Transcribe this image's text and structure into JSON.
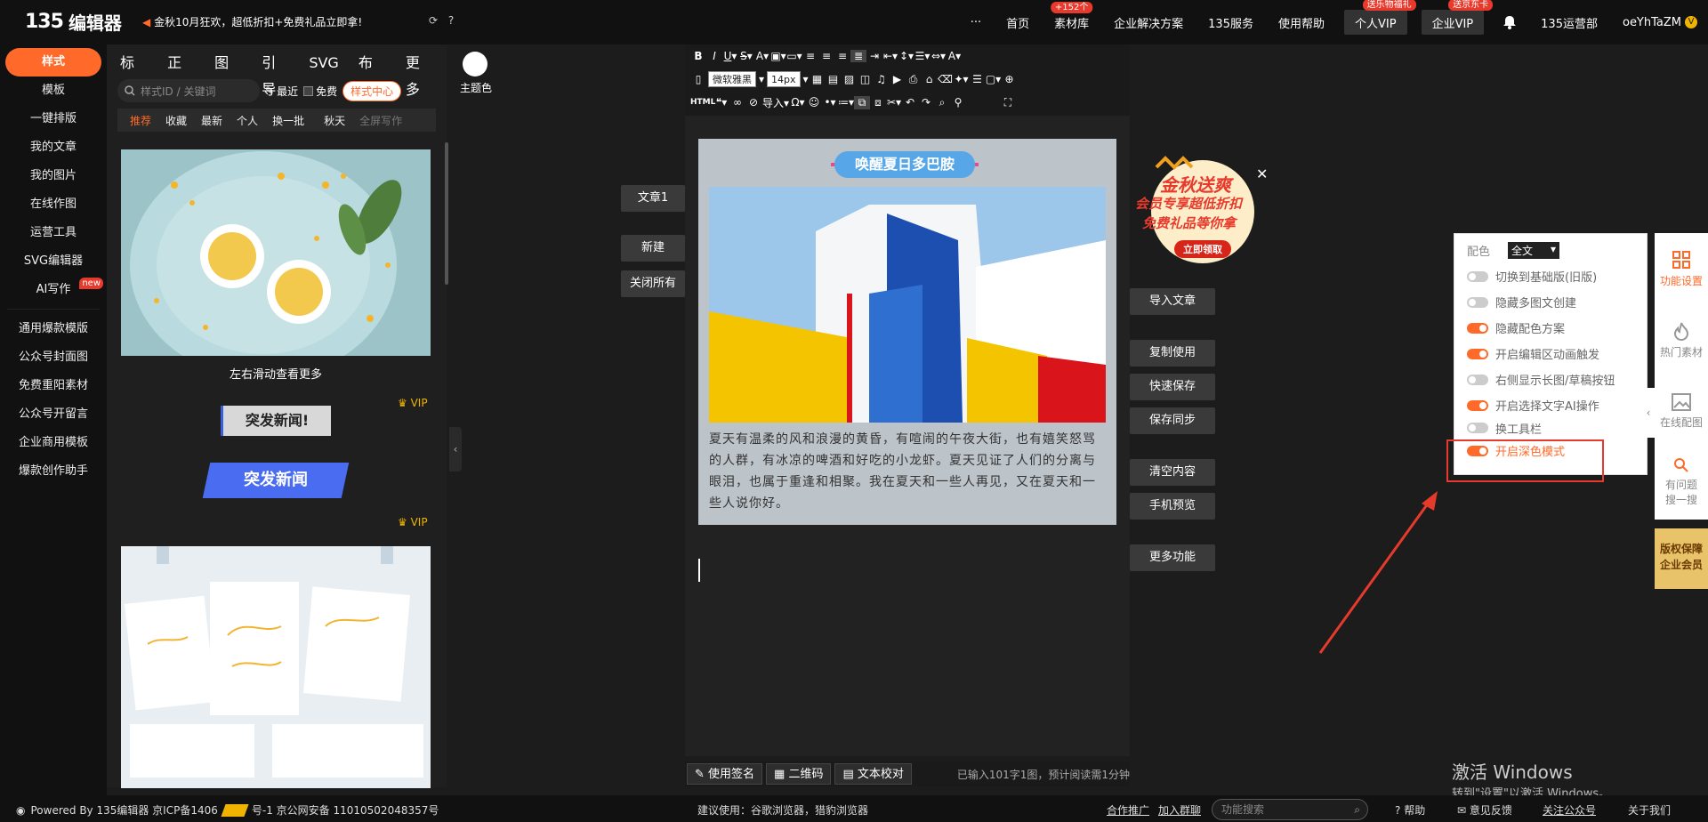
{
  "header": {
    "logo_num": "135",
    "logo_text": "编辑器",
    "promo": "金秋10月狂欢，超低折扣+免费礼品立即拿!",
    "nav": [
      {
        "label": "···"
      },
      {
        "label": "首页"
      },
      {
        "label": "素材库",
        "badge": "+152个"
      },
      {
        "label": "企业解决方案"
      },
      {
        "label": "135服务"
      },
      {
        "label": "使用帮助"
      }
    ],
    "vip_personal": "个人VIP",
    "vip_personal_badge": "送乐物福礼",
    "vip_enterprise": "企业VIP",
    "vip_enterprise_badge": "送京东卡",
    "org": "135运营部",
    "user": "oeYhTaZM"
  },
  "left_sidebar": {
    "active": "样式",
    "items": [
      "模板",
      "一键排版",
      "我的文章",
      "我的图片",
      "在线作图",
      "运营工具",
      "SVG编辑器",
      "AI写作"
    ],
    "ai_badge": "new",
    "extra": [
      "通用爆款模版",
      "公众号封面图",
      "免费重阳素材",
      "公众号开留言",
      "企业商用模板",
      "爆款创作助手"
    ]
  },
  "style_panel": {
    "tabs": [
      "标题",
      "正文",
      "图文",
      "引导",
      "SVG",
      "布局",
      "更多"
    ],
    "search_placeholder": "样式ID / 关键词",
    "recent": "最近",
    "free": "免费",
    "style_center": "样式中心",
    "filters": [
      "推荐",
      "收藏",
      "最新",
      "个人",
      "换一批",
      "秋天",
      "全屏写作"
    ],
    "vip_label": "VIP",
    "card1_caption": "左右滑动查看更多",
    "news1": "突发新闻!",
    "news2": "突发新闻"
  },
  "theme": {
    "label": "主题色"
  },
  "article_buttons": {
    "article1": "文章1",
    "new": "新建",
    "close_all": "关闭所有"
  },
  "toolbar": {
    "font": "微软雅黑",
    "size": "14px",
    "html": "HTML",
    "import": "导入"
  },
  "editor": {
    "title": "唤醒夏日多巴胺",
    "paragraph": "夏天有温柔的风和浪漫的黄昏，有喧闹的午夜大街，也有嬉笑怒骂的人群，有冰凉的啤酒和好吃的小龙虾。夏天见证了人们的分离与眼泪，也属于重逢和相聚。我在夏天和一些人再见，又在夏天和一些人说你好。",
    "status_buttons": [
      "使用签名",
      "二维码",
      "文本校对"
    ],
    "word_count": "已输入101字1图，预计阅读需1分钟"
  },
  "actions": [
    "导入文章",
    "复制使用",
    "快速保存",
    "保存同步",
    "清空内容",
    "手机预览",
    "更多功能"
  ],
  "ad": {
    "line1": "金秋送爽",
    "line2": "会员专享超低折扣",
    "line3": "免费礼品等你拿",
    "cta": "立即领取"
  },
  "settings": {
    "color_label": "配色",
    "color_value": "全文",
    "options": [
      {
        "label": "切换到基础版(旧版)",
        "on": false
      },
      {
        "label": "隐藏多图文创建",
        "on": false
      },
      {
        "label": "隐藏配色方案",
        "on": true
      },
      {
        "label": "开启编辑区动画触发",
        "on": true
      },
      {
        "label": "右侧显示长图/草稿按钮",
        "on": false
      },
      {
        "label": "开启选择文字AI操作",
        "on": true
      },
      {
        "label": "换工具栏",
        "on": false
      },
      {
        "label": "开启深色模式",
        "on": true
      }
    ]
  },
  "right_tools": [
    "功能设置",
    "热门素材",
    "在线配图",
    "有问题搜一搜"
  ],
  "copyright_badge": {
    "line1": "版权保障",
    "line2": "企业会员"
  },
  "windows": {
    "title": "激活 Windows",
    "sub": "转到\"设置\"以激活 Windows。"
  },
  "footer": {
    "powered": "Powered By 135编辑器 京ICP备1406",
    "police": "号-1 京公网安备 11010502048357号",
    "browser": "建议使用：谷歌浏览器，猎豹浏览器",
    "links": [
      "合作推广",
      "加入群聊"
    ],
    "search_placeholder": "功能搜索",
    "help": "帮助",
    "feedback": "意见反馈",
    "follow": "关注公众号",
    "about": "关于我们"
  }
}
